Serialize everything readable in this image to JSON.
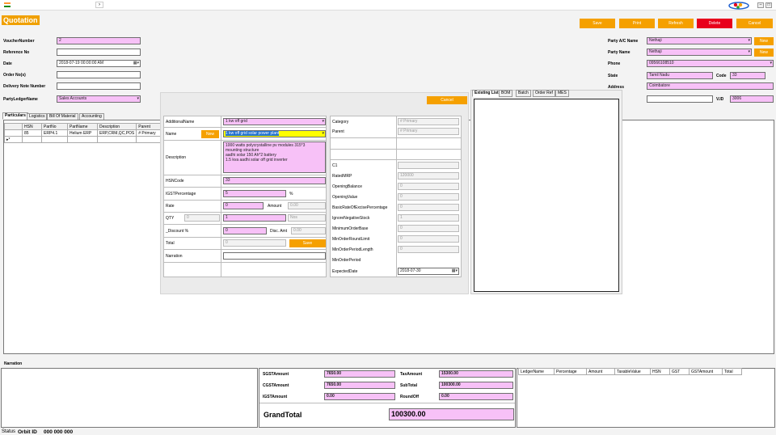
{
  "titlebar": {
    "flag_icon": "india-flag-icon",
    "nav_arrow": "›",
    "min": "–",
    "max": "□"
  },
  "header": {
    "title": "Quotation"
  },
  "toolbar": {
    "save": "Save",
    "print": "Print",
    "refresh": "Refresh",
    "delete": "Delete",
    "cancel": "Cancel"
  },
  "form": {
    "voucher_label": "VoucherNumber",
    "voucher_value": "2",
    "reference_label": "Reference No",
    "reference_value": "",
    "date_label": "Date",
    "date_value": "2018-07-19 00:00:00 AM",
    "order_label": "Order No(s)",
    "order_value": "",
    "delivery_label": "Delivery Note Number",
    "delivery_value": "",
    "ledger_label": "PartyLedgerName",
    "ledger_value": "Sales Accounts",
    "party_ac_label": "Party A/C Name",
    "party_ac_value": "Nethaji",
    "party_name_label": "Party Name",
    "party_name_value": "Nethaji",
    "phone_label": "Phone",
    "phone_value": "09566108510",
    "state_label": "State",
    "state_value": "Tamil Nadu",
    "code_label": "Code",
    "code_value": "33",
    "address_label": "Address",
    "address_value": "Coimbatore",
    "vid_label": "V.ID",
    "vid_value": "3006",
    "new_label": "New"
  },
  "main_tabs": [
    "Particulars",
    "Logistics",
    "Bill Of Material",
    "Accounting"
  ],
  "particulars": {
    "columns": [
      "HSN",
      "PartNo",
      "PartName",
      "Description",
      "Parent",
      "G"
    ],
    "row": [
      "85",
      "ERP4.1",
      "Helium ERP",
      "ERP,CRM,QC,POS",
      "# Primary",
      ""
    ],
    "new_row_marker": "▸*"
  },
  "popup": {
    "cancel": "Cancel",
    "additional_label": "AdditionalName",
    "additional_value": "1 kw off grid",
    "name_label": "Name",
    "name_new": "New",
    "name_value": "1 kw off grid solar power plant",
    "description_label": "Description",
    "description_lines": [
      "1000 watts polycrystalline pv modules 315*3",
      "mounting structure",
      "aadhi solar 150 Ah*2  battery",
      "1.5 kva aadhi solar off grid inverter"
    ],
    "hsn_label": "HSNCode",
    "hsn_value": "33",
    "igst_label": "IGSTPercentage",
    "igst_value": "5",
    "pct": "%",
    "rate_label": "Rate",
    "rate_value": "0",
    "amount_label": "Amount",
    "amount_value": "0.00",
    "qty_label": "QTY",
    "qty_left": "0",
    "qty_value": "1",
    "qty_unit": "Nos",
    "discount_label": "_Discount %",
    "discount_value": "0",
    "disc_amt_label": "Disc. Amt",
    "disc_amt_value": "0.00",
    "total_label": "Total",
    "total_value": "0",
    "save": "Save",
    "narration_label": "Narration",
    "narration_value": "",
    "category_label": "Category",
    "category_value": "# Primary",
    "parent_label": "Parent",
    "parent_value": "# Primary",
    "c1_label": "C1",
    "c1_value": "",
    "mrp_label": "RatedMRP",
    "mrp_value": "120000",
    "ob_label": "OpeningBalance",
    "ob_value": "0",
    "ov_label": "OpeningValue",
    "ov_value": "0",
    "brep_label": "BasicRateOfExcisePercentage",
    "brep_value": "0",
    "ins_label": "IgnoreNegativeStock",
    "ins_value": "1",
    "mob_label": "MinimumOrderBase",
    "mob_value": "0",
    "mor_label": "MinOrderRoundLimit",
    "mor_value": "0",
    "mopl_label": "MinOrderPeriodLength",
    "mopl_value": "0",
    "mop_label": "MinOrderPeriod",
    "mop_value": "",
    "exp_label": "ExpectedDate",
    "exp_value": "2018-07-30"
  },
  "side_tabs": [
    "Existing List",
    "BOM",
    "Batch",
    "Order Ref",
    "MES"
  ],
  "narration": {
    "label": "Narration"
  },
  "totals": {
    "sgst_label": "SGSTAmount",
    "sgst_value": "7650.00",
    "cgst_label": "CGSTAmount",
    "cgst_value": "7650.00",
    "igst_label": "IGSTAmount",
    "igst_value": "0.00",
    "tax_label": "TaxAmount",
    "tax_value": "15300.00",
    "subtotal_label": "SubTotal",
    "subtotal_value": "100300.00",
    "roundoff_label": "RoundOff",
    "roundoff_value": "0.00",
    "grand_label": "GrandTotal",
    "grand_value": "100300.00"
  },
  "ledger_columns": [
    "LedgerName",
    "Percentage",
    "Amount",
    "TaxableValue",
    "HSN",
    "GST",
    "GSTAmount",
    "Total"
  ],
  "status": {
    "label": "Status",
    "orbit": "Orbit ID",
    "number": "000 000 000"
  },
  "colors": {
    "accent": "#f5a000",
    "delete": "#e8001c",
    "pink": "#f7c1f7",
    "title_bg": "#f0a000"
  }
}
